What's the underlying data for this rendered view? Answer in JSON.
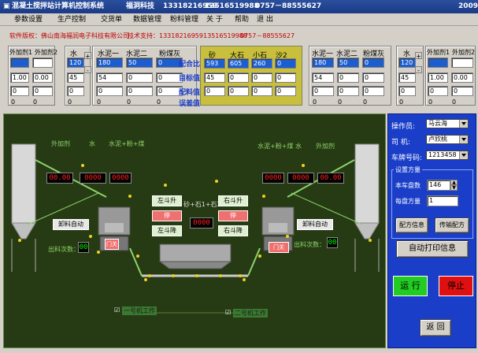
{
  "title": {
    "app": "混凝土搅拌站计算机控制系统",
    "company": "福洞科技",
    "phone1": "13318216959",
    "phone2": "13516519988",
    "phone3": "0757－88555627",
    "year": "2009"
  },
  "menu": [
    "参数设置",
    "生产控制",
    "交货单",
    "数据管理",
    "粉料管理",
    "关 于",
    "帮助",
    "退 出"
  ],
  "info": {
    "copyright": "软件版权：佛山南海福润电子科技有限公司",
    "support": "技术支持：13318216959",
    "phone2": "13516519988",
    "phone3": "0757－88555627"
  },
  "ingredients": {
    "additives1": {
      "h1": "外加剂1",
      "h2": "外加剂2",
      "v1": "1.00",
      "v2": "0.00",
      "s1": "0",
      "s2": "0",
      "r1": "0",
      "r2": "0"
    },
    "water1": {
      "h": "水",
      "v": "120",
      "v2": "45",
      "s": "0",
      "r": "0"
    },
    "cement1": {
      "h1": "水泥一",
      "h2": "水泥二",
      "h3": "粉煤灰",
      "v1": "180",
      "v2": "50",
      "v3": "0",
      "w1": "54",
      "w2": "0",
      "w3": "0",
      "s1": "0",
      "s2": "0",
      "s3": "0",
      "r1": "0",
      "r2": "0",
      "r3": "0"
    },
    "aggregates": {
      "h": [
        "砂",
        "大石",
        "小石",
        "沙2"
      ],
      "ratio": [
        "593",
        "605",
        "260",
        "0"
      ],
      "weight": [
        "45",
        "0",
        "0",
        "0"
      ],
      "set": [
        "0",
        "0",
        "0",
        "0"
      ],
      "row_labels": [
        "配合比",
        "目标值",
        "配料值",
        "误差值"
      ]
    },
    "cement2": {
      "h1": "水泥一",
      "h2": "水泥二",
      "h3": "粉煤灰",
      "v1": "180",
      "v2": "50",
      "v3": "0",
      "w1": "54",
      "w2": "0",
      "w3": "0",
      "s1": "0",
      "s2": "0",
      "s3": "0",
      "r1": "0",
      "r2": "0",
      "r3": "0"
    },
    "water2": {
      "h": "水",
      "v": "120",
      "v2": "45",
      "s": "0",
      "r": "0"
    },
    "additives2": {
      "h1": "外加剂1",
      "h2": "外加剂2",
      "v1": "1.00",
      "v2": "0.00",
      "s1": "0",
      "s2": "0",
      "r1": "0",
      "r2": "0"
    }
  },
  "scene": {
    "labels_left": [
      "外加剂",
      "水",
      "水泥+粉+煤"
    ],
    "labels_right": [
      "水泥+粉+煤",
      "水",
      "外加剂"
    ],
    "led_left": [
      "00.00",
      "0000",
      "0000"
    ],
    "led_right": [
      "0000",
      "0000",
      "00.00"
    ],
    "left_up": "左斗升",
    "stop": "停",
    "left_down": "左斗降",
    "right_up": "右斗升",
    "right_down": "右斗降",
    "formula": "砂+石1+石2",
    "center_led": "0000",
    "unload_left": "卸料自动",
    "unload_right": "卸料自动",
    "count_left": "出料次数：",
    "count_right": "出料次数：",
    "count_left_val": "00",
    "count_right_val": "00",
    "door": "门关",
    "machine1": "一号机工作",
    "machine2": "二号机工作"
  },
  "right": {
    "operator_label": "操作员:",
    "operator": "马云海",
    "driver_label": "司 机:",
    "driver": "卢欣桃",
    "plate_label": "车牌号码:",
    "plate": "1213458",
    "group_label": "设置方量",
    "trucks_label": "本车盘数",
    "trucks": "146",
    "per_label": "每盘方量",
    "per": "1",
    "recipe_btn": "配方信息",
    "send_btn": "传输配方",
    "autoprint": "自动打印信息",
    "run": "运 行",
    "stop": "停止",
    "back": "返 回"
  },
  "colors": {
    "scene_bg": "#263b14",
    "right_bg": "#1a3ec8",
    "yellow": "#c8c03c",
    "run": "#22cc22",
    "stop": "#e01010"
  }
}
